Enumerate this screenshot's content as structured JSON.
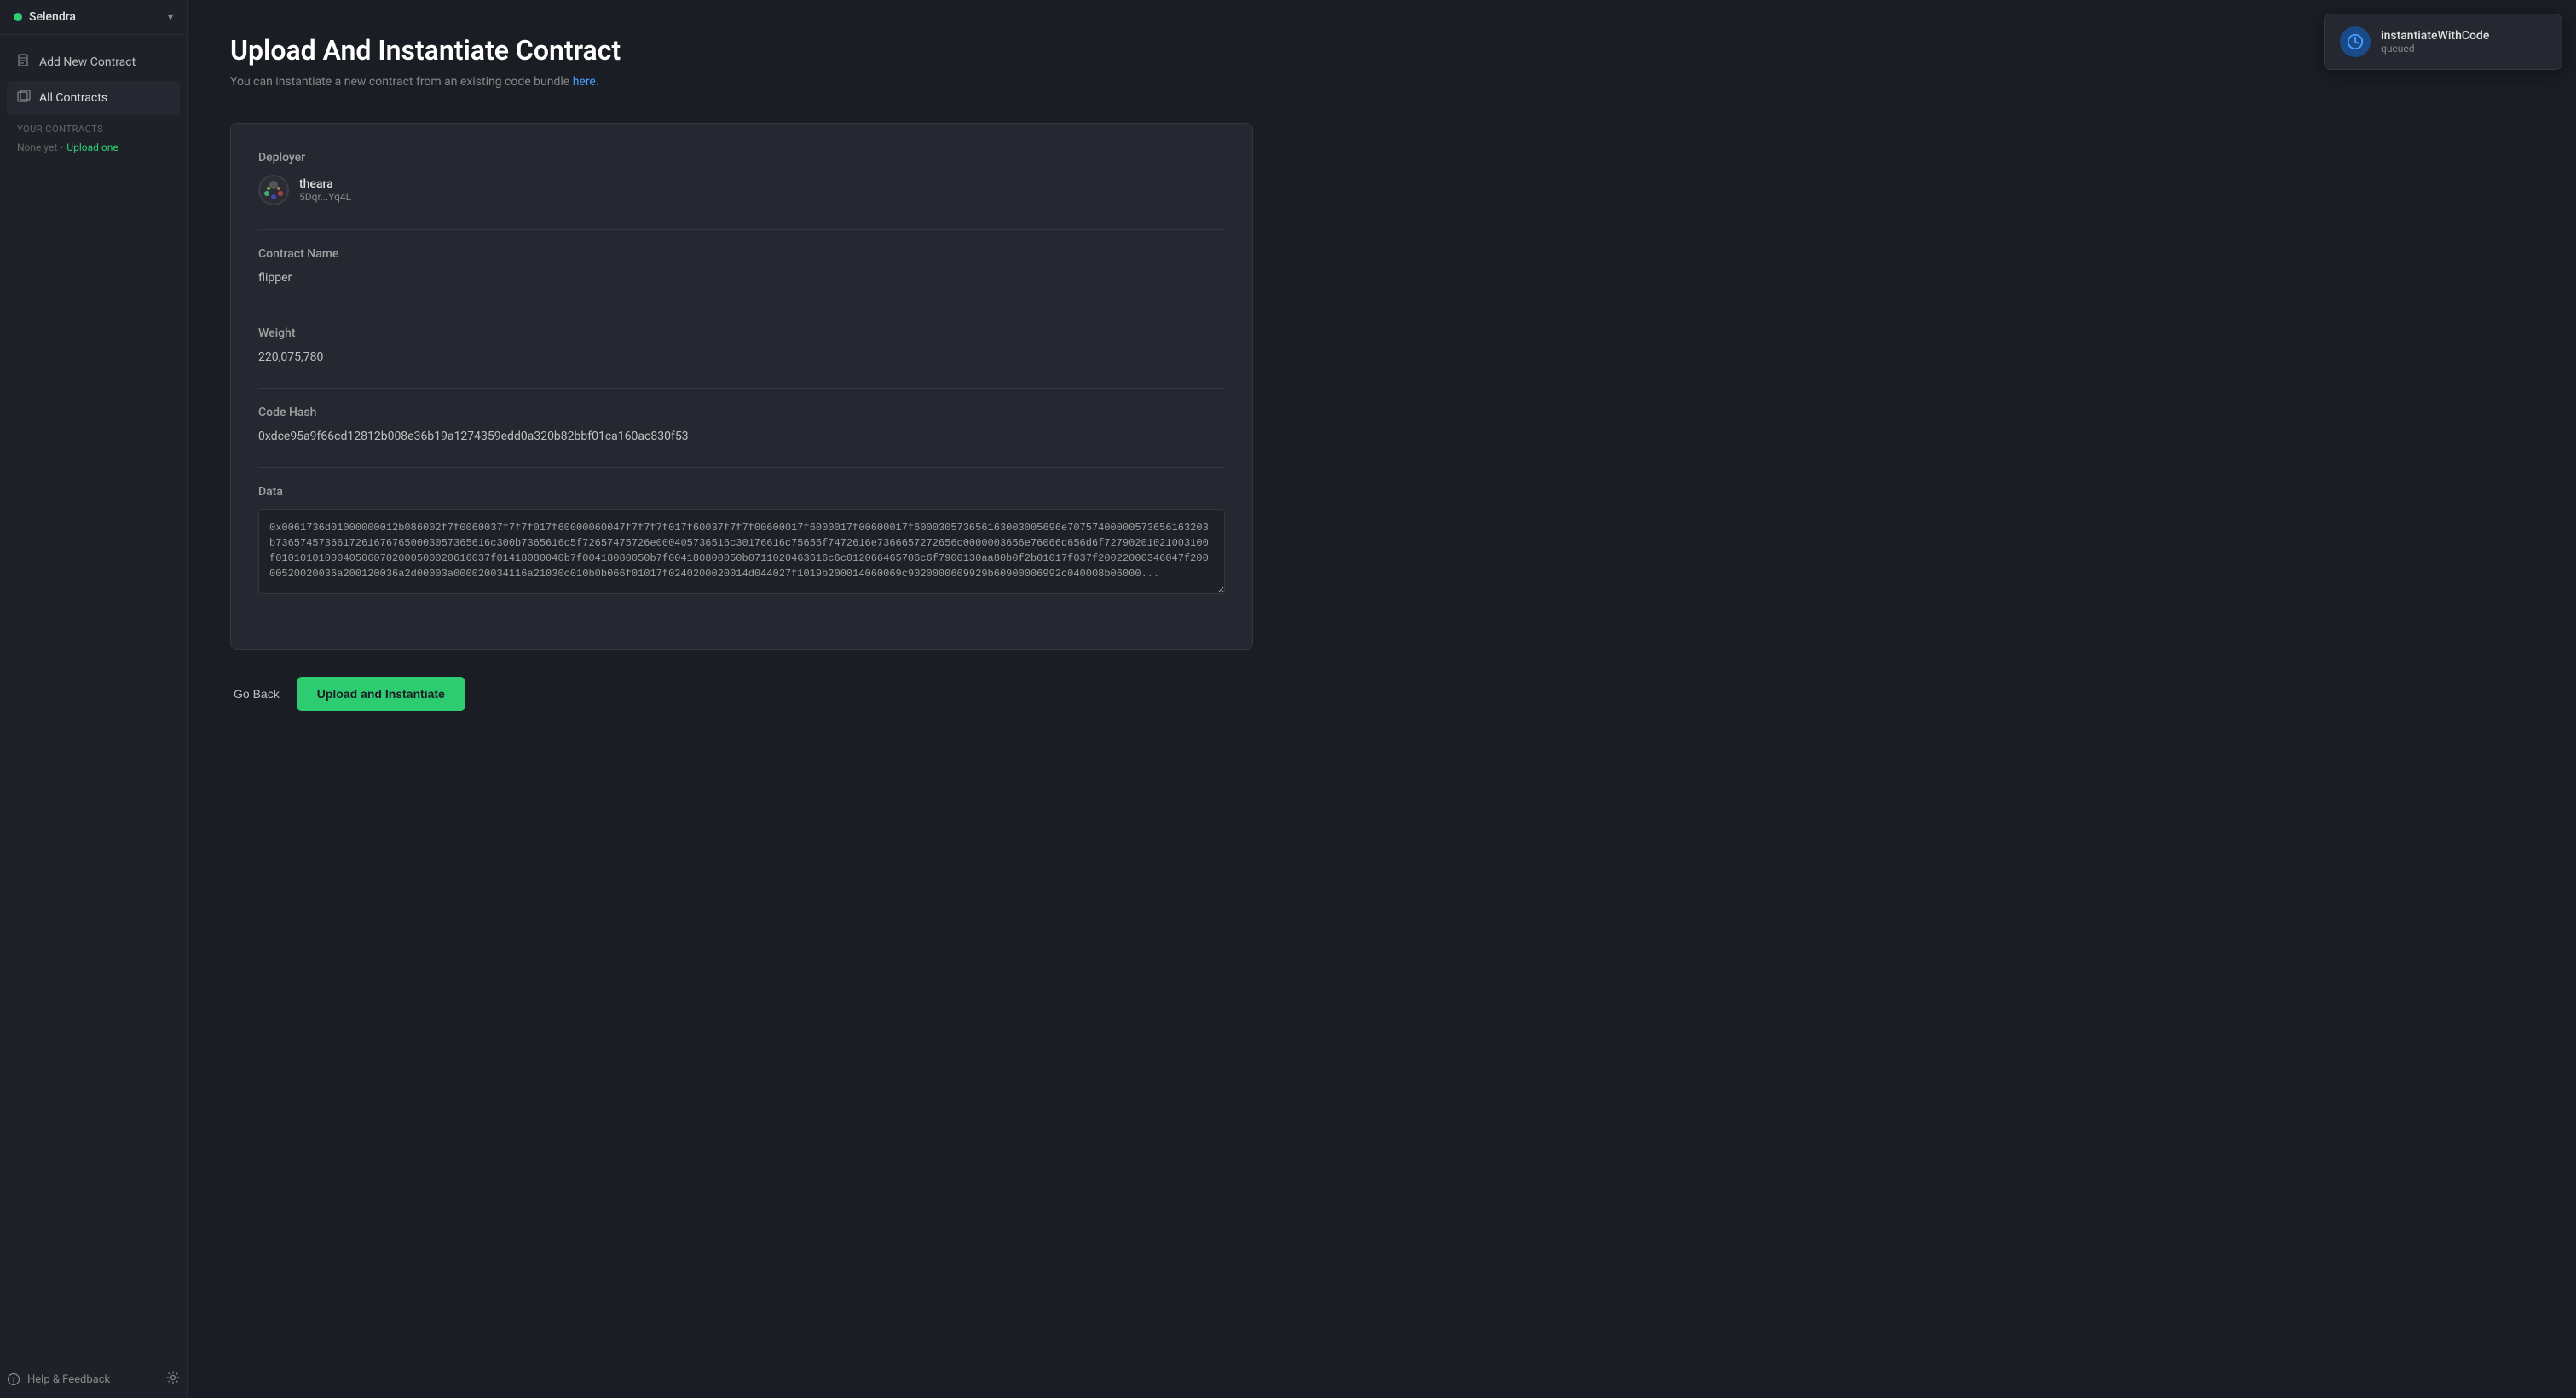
{
  "sidebar": {
    "network": {
      "name": "Selendra",
      "status": "connected",
      "dot_color": "#2ecc71"
    },
    "nav_items": [
      {
        "id": "add-new-contract",
        "label": "Add New Contract",
        "icon": "📄"
      },
      {
        "id": "all-contracts",
        "label": "All Contracts",
        "icon": "📦"
      }
    ],
    "contracts_section": {
      "label": "Your Contracts",
      "none_text": "None yet •",
      "upload_text": "Upload one"
    },
    "footer": {
      "help_label": "Help & Feedback",
      "settings_icon": "⚙"
    }
  },
  "main": {
    "title": "Upload And Instantiate Contract",
    "subtitle": "You can instantiate a new contract from an existing code bundle",
    "subtitle_link_text": "here.",
    "subtitle_link_href": "#"
  },
  "form": {
    "deployer_label": "Deployer",
    "deployer_name": "theara",
    "deployer_address": "5Dqr...Yq4L",
    "contract_name_label": "Contract Name",
    "contract_name_value": "flipper",
    "weight_label": "Weight",
    "weight_value": "220,075,780",
    "code_hash_label": "Code Hash",
    "code_hash_value": "0xdce95a9f66cd12812b008e36b19a1274359edd0a320b82bbf01ca160ac830f53",
    "data_label": "Data",
    "data_value": "0x0061736d01000000012b086002f7f0060037f7f7f017f60000060047f7f7f7f017f60037f7f7f00600017f6000017f00600017f600030573656163003005696e70757400000573656163203b73657457366172616767650003057365616c300b7365616c5f72657475726e000405736516c30176616c75655f7472616e7366657272656c0000003656e76066d656d6f72790201021003100f01010101000405060702000500020616037f01418080040b7f00418080050b7f004180800050b0711020463616c6c012066465706c6f7900130aa80b0f2b01017f037f20022000346047f20000520020036a200120036a2d00003a000020034116a21030c010b0b066f01017f0240200020014d044027f1019b200014060069c9020000609929b60900006992c040008b06000..."
  },
  "buttons": {
    "go_back": "Go Back",
    "upload_instantiate": "Upload and Instantiate"
  },
  "toast": {
    "title": "instantiateWithCode",
    "status": "queued",
    "icon": "clock"
  }
}
